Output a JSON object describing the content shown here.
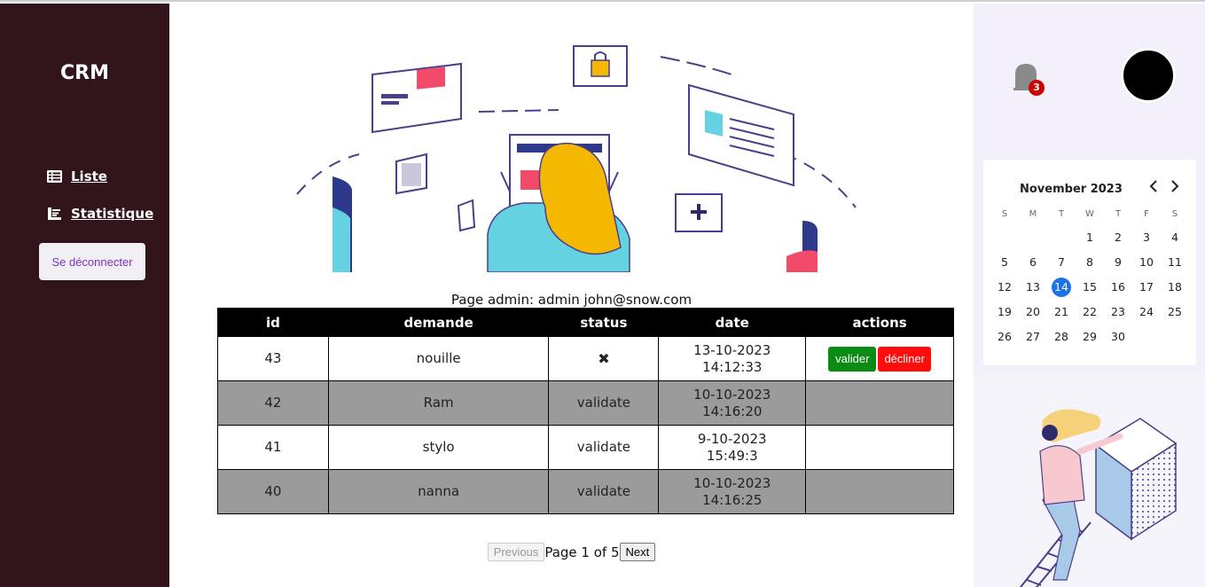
{
  "sidebar": {
    "logo": "CRM",
    "nav": [
      {
        "label": "Liste",
        "icon": "list-icon"
      },
      {
        "label": "Statistique",
        "icon": "chart-icon"
      }
    ],
    "logout_label": "Se déconnecter"
  },
  "main": {
    "page_admin": "Page admin: admin john@snow.com",
    "table": {
      "headers": [
        "id",
        "demande",
        "status",
        "date",
        "actions"
      ],
      "rows": [
        {
          "id": "43",
          "demande": "nouille",
          "status": "✖",
          "date": "13-10-2023",
          "time": "14:12:33",
          "actions": true
        },
        {
          "id": "42",
          "demande": "Ram",
          "status": "validate",
          "date": "10-10-2023",
          "time": "14:16:20",
          "actions": false
        },
        {
          "id": "41",
          "demande": "stylo",
          "status": "validate",
          "date": "9-10-2023",
          "time": "15:49:3",
          "actions": false
        },
        {
          "id": "40",
          "demande": "nanna",
          "status": "validate",
          "date": "10-10-2023",
          "time": "14:16:25",
          "actions": false
        }
      ],
      "validate_label": "valider",
      "decline_label": "décliner"
    },
    "pager": {
      "previous": "Previous",
      "text": "Page 1 of 5",
      "next": "Next"
    }
  },
  "right": {
    "notification_count": "3",
    "calendar": {
      "title": "November 2023",
      "prev": "‹",
      "next": "›",
      "weekdays": [
        "S",
        "M",
        "T",
        "W",
        "T",
        "F",
        "S"
      ],
      "leading_blanks": 3,
      "days": 30,
      "today": 14
    }
  },
  "colors": {
    "sidebar": "#32141b",
    "valider": "#0a8c12",
    "decliner": "#ff0d0d",
    "today": "#1a73e8"
  }
}
